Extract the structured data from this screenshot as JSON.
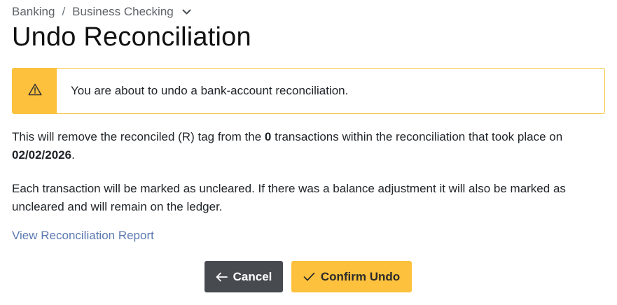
{
  "breadcrumb": {
    "items": [
      "Banking",
      "Business Checking"
    ],
    "separator": "/",
    "dropdown_icon": "chevron-down-icon"
  },
  "page": {
    "title": "Undo Reconciliation"
  },
  "alert": {
    "icon": "warning-triangle-icon",
    "message": "You are about to undo a bank-account reconciliation.",
    "colors": {
      "accent": "#fec13d",
      "border": "#f4c542"
    }
  },
  "body": {
    "para1_prefix": "This will remove the reconciled (R) tag from the ",
    "transaction_count": "0",
    "para1_middle": " transactions within the reconciliation that took place on ",
    "reconciliation_date": "02/02/2026",
    "para1_suffix": ".",
    "para2": "Each transaction will be marked as uncleared. If there was a balance adjustment it will also be marked as uncleared and will remain on the ledger."
  },
  "links": {
    "view_report": "View Reconciliation Report"
  },
  "actions": {
    "cancel_label": "Cancel",
    "cancel_icon": "arrow-left-icon",
    "confirm_label": "Confirm Undo",
    "confirm_icon": "check-icon",
    "colors": {
      "cancel_bg": "#474b50",
      "confirm_bg": "#fec13d"
    }
  }
}
